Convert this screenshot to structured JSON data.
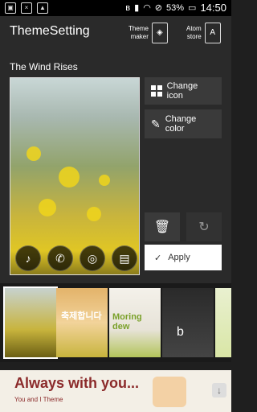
{
  "statusbar": {
    "battery": "53%",
    "time": "14:50"
  },
  "appbar": {
    "title": "ThemeSetting",
    "theme_maker": "Theme\nmaker",
    "atom_store": "Atom\nstore",
    "atom_store_icon": "A"
  },
  "main": {
    "section_title": "The Wind Rises",
    "change_icon_label": "Change icon",
    "change_color_label": "Change\ncolor",
    "apply_label": "Apply"
  },
  "thumbnails": [
    {
      "name": "thumb-wind-rises",
      "text": ""
    },
    {
      "name": "thumb-korean",
      "text": "축제합니다"
    },
    {
      "name": "thumb-moring-dew",
      "text": "Moring dew"
    },
    {
      "name": "thumb-bike",
      "text": "b"
    },
    {
      "name": "thumb-partial",
      "text": ""
    }
  ],
  "ad": {
    "headline": "Always with you...",
    "sub": "You and I Theme"
  }
}
